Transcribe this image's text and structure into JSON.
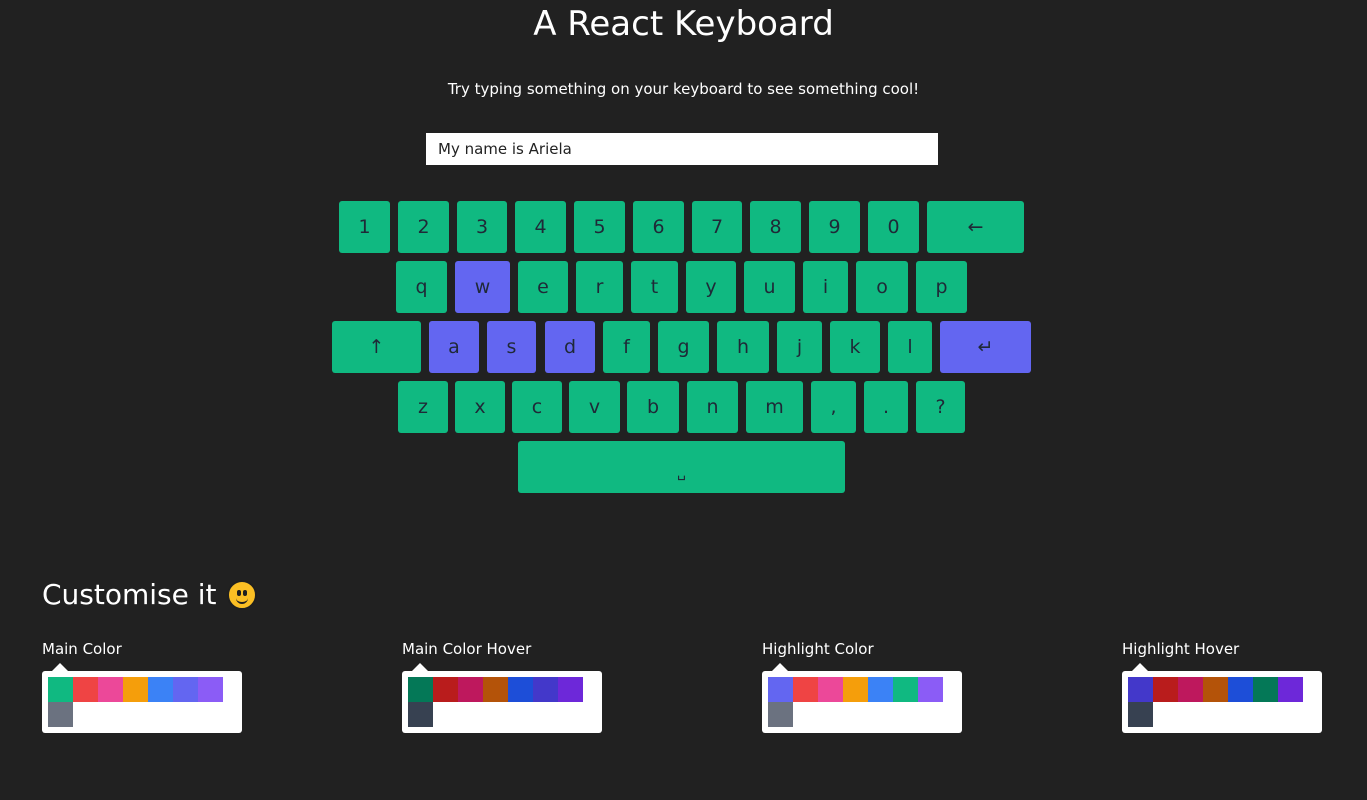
{
  "header": {
    "title": "A React Keyboard",
    "subtitle": "Try typing something on your keyboard to see something cool!"
  },
  "input": {
    "value": "My name is Ariela"
  },
  "keyboard": {
    "rows": [
      [
        "1",
        "2",
        "3",
        "4",
        "5",
        "6",
        "7",
        "8",
        "9",
        "0",
        "←"
      ],
      [
        "q",
        "w",
        "e",
        "r",
        "t",
        "y",
        "u",
        "i",
        "o",
        "p"
      ],
      [
        "↑",
        "a",
        "s",
        "d",
        "f",
        "g",
        "h",
        "j",
        "k",
        "l",
        "↵"
      ],
      [
        "z",
        "x",
        "c",
        "v",
        "b",
        "n",
        "m",
        ",",
        ".",
        "?"
      ],
      [
        "␣"
      ]
    ],
    "highlighted": [
      "w",
      "a",
      "s",
      "d",
      "↵"
    ],
    "main_color": "#10b981",
    "highlight_color": "#6366f1"
  },
  "customise": {
    "title": "Customise it",
    "emoji_icon": "smiley-face-icon",
    "pickers": [
      {
        "label": "Main Color",
        "colors": [
          "#10b981",
          "#ef4444",
          "#ec4899",
          "#f59e0b",
          "#3b82f6",
          "#6366f1",
          "#8b5cf6",
          "#6b7280"
        ]
      },
      {
        "label": "Main Color Hover",
        "colors": [
          "#047857",
          "#b91c1c",
          "#be185d",
          "#b45309",
          "#1d4ed8",
          "#4338ca",
          "#6d28d9",
          "#374151"
        ]
      },
      {
        "label": "Highlight Color",
        "colors": [
          "#6366f1",
          "#ef4444",
          "#ec4899",
          "#f59e0b",
          "#3b82f6",
          "#10b981",
          "#8b5cf6",
          "#6b7280"
        ]
      },
      {
        "label": "Highlight Hover",
        "colors": [
          "#4338ca",
          "#b91c1c",
          "#be185d",
          "#b45309",
          "#1d4ed8",
          "#047857",
          "#6d28d9",
          "#374151"
        ]
      }
    ]
  }
}
